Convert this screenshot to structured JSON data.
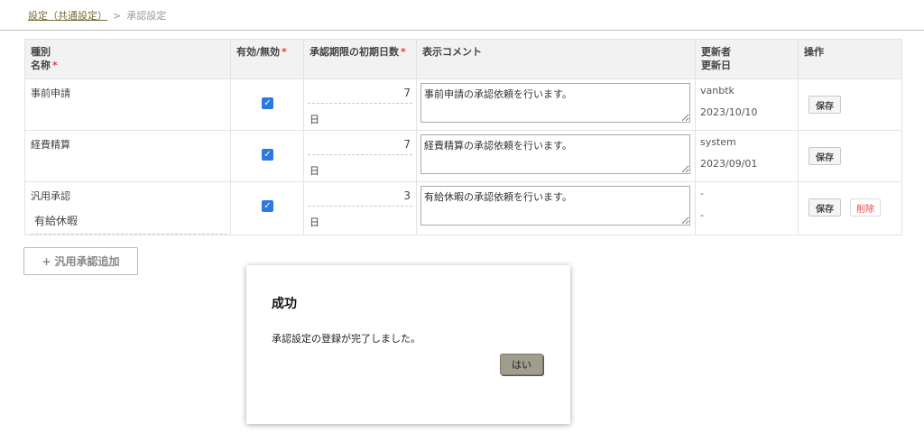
{
  "breadcrumb": {
    "parent": "設定（共通設定）",
    "separator": ">",
    "current": "承認設定"
  },
  "table": {
    "headers": {
      "type": "種別",
      "name": "名称",
      "enabled": "有効/無効",
      "days": "承認期限の初期日数",
      "comment": "表示コメント",
      "updater": "更新者",
      "updated_at": "更新日",
      "actions": "操作"
    },
    "rows": [
      {
        "type": "事前申請",
        "name": "",
        "enabled": true,
        "days": "7",
        "unit": "日",
        "comment": "事前申請の承認依頼を行います。",
        "updater": "vanbtk",
        "updated_at": "2023/10/10",
        "save_label": "保存",
        "delete_label": ""
      },
      {
        "type": "経費精算",
        "name": "",
        "enabled": true,
        "days": "7",
        "unit": "日",
        "comment": "経費精算の承認依頼を行います。",
        "updater": "system",
        "updated_at": "2023/09/01",
        "save_label": "保存",
        "delete_label": ""
      },
      {
        "type": "汎用承認",
        "name": "有給休暇",
        "enabled": true,
        "days": "3",
        "unit": "日",
        "comment": "有給休暇の承認依頼を行います。",
        "updater": "-",
        "updated_at": "-",
        "save_label": "保存",
        "delete_label": "削除"
      }
    ]
  },
  "add_button": {
    "plus": "+",
    "label": "汎用承認追加"
  },
  "dialog": {
    "title": "成功",
    "message": "承認設定の登録が完了しました。",
    "ok_label": "はい"
  },
  "colors": {
    "accent": "#2a7ae2",
    "required": "#e04040",
    "delete": "#e04848"
  }
}
